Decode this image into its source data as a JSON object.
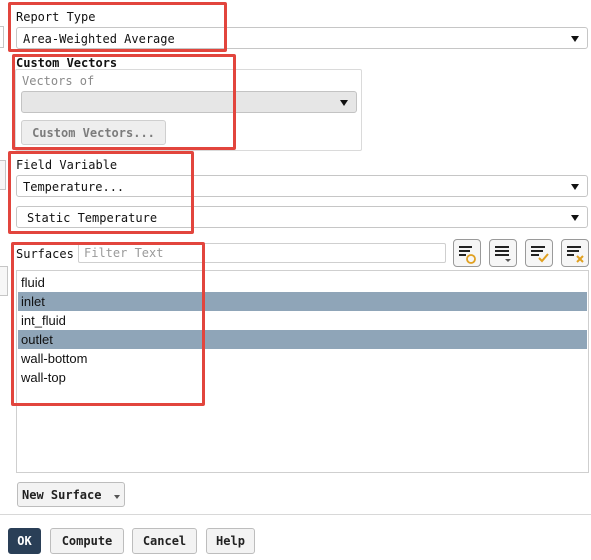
{
  "report_type": {
    "label": "Report Type",
    "value": "Area-Weighted Average"
  },
  "custom_vectors": {
    "title": "Custom Vectors",
    "vectors_of_label": "Vectors of",
    "vectors_of_value": "",
    "button_label": "Custom Vectors..."
  },
  "field_variable": {
    "label": "Field Variable",
    "category_value": "Temperature...",
    "variable_value": "Static Temperature"
  },
  "surfaces": {
    "label": "Surfaces",
    "filter_placeholder": "Filter Text",
    "items": [
      {
        "name": "fluid",
        "selected": false
      },
      {
        "name": "inlet",
        "selected": true
      },
      {
        "name": "int_fluid",
        "selected": false
      },
      {
        "name": "outlet",
        "selected": true
      },
      {
        "name": "wall-bottom",
        "selected": false
      },
      {
        "name": "wall-top",
        "selected": false
      }
    ],
    "toolbar_icons": [
      "filter-icon",
      "list-menu-icon",
      "select-all-icon",
      "deselect-all-icon"
    ]
  },
  "new_surface_label": "New Surface",
  "buttons": {
    "ok": "OK",
    "compute": "Compute",
    "cancel": "Cancel",
    "help": "Help"
  },
  "colors": {
    "selection": "#8fa5b8",
    "highlight_box": "#e2453d",
    "primary_button": "#2a3f57"
  }
}
